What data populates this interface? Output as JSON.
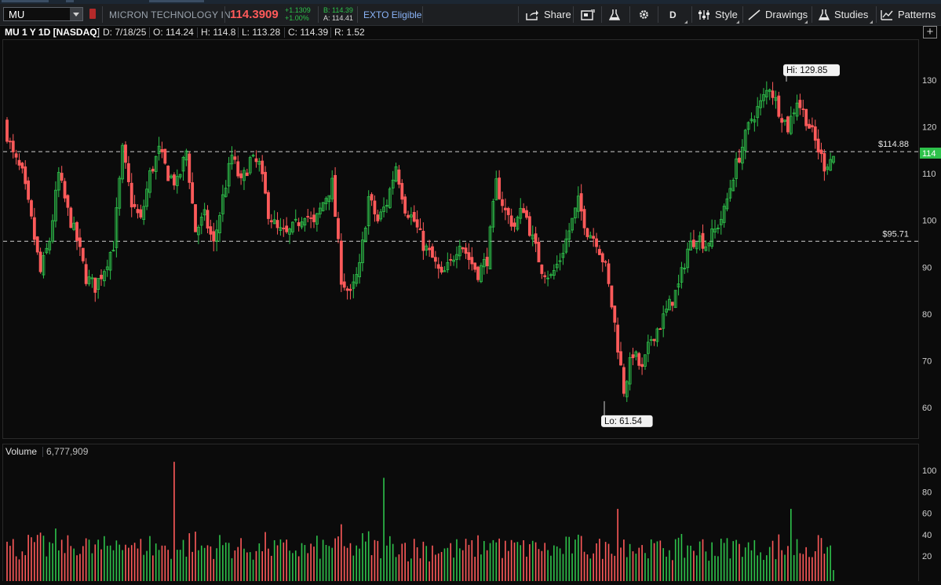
{
  "toolbar": {
    "symbol": "MU",
    "company_name": "MICRON TECHNOLOGY IN",
    "last_price": "114.3909",
    "net_change": "+1.1309",
    "pct_change": "+1.00%",
    "bid": "B: 114.39",
    "ask": "A: 114.41",
    "ext_tag": "EXTO Eligible",
    "share_label": "Share",
    "aggregation_label": "D",
    "style_label": "Style",
    "drawings_label": "Drawings",
    "studies_label": "Studies",
    "patterns_label": "Patterns",
    "colors": {
      "up": "#2ec24b",
      "down": "#ff5a5a",
      "accent": "#8ab4f8"
    }
  },
  "info_bar": {
    "title": "MU 1 Y 1D [NASDAQ]",
    "date": "D: 7/18/25",
    "open": "O: 114.24",
    "high": "H: 114.8",
    "low": "L: 113.28",
    "close": "C: 114.39",
    "range": "R: 1.52"
  },
  "volume_header": {
    "label": "Volume",
    "value": "6,777,909"
  },
  "chart_data": [
    {
      "type": "candlestick",
      "title": "MU 1 Y 1D [NASDAQ]",
      "ylim": [
        56,
        138
      ],
      "y_ticks": [
        60,
        70,
        80,
        90,
        100,
        110,
        120,
        130
      ],
      "grid": false,
      "high_marker": {
        "label": "Hi: 129.85",
        "value": 129.85,
        "date": "late June 2025"
      },
      "low_marker": {
        "label": "Lo: 61.54",
        "value": 61.54,
        "date": "early April 2025"
      },
      "price_lines": [
        {
          "label": "$114.88",
          "value": 114.88,
          "style": "dashed"
        },
        {
          "label": "$95.71",
          "value": 95.71,
          "style": "dashed"
        }
      ],
      "last_price_tag": {
        "label": "114",
        "value": 114.39,
        "color": "#2ec24b"
      },
      "candles_approx": [
        [
          121,
          114
        ],
        [
          114,
          110
        ],
        [
          110,
          100
        ],
        [
          100,
          89
        ],
        [
          89,
          96
        ],
        [
          96,
          110
        ],
        [
          110,
          102
        ],
        [
          102,
          96
        ],
        [
          96,
          88
        ],
        [
          88,
          86
        ],
        [
          86,
          90
        ],
        [
          90,
          95
        ],
        [
          95,
          115
        ],
        [
          115,
          104
        ],
        [
          104,
          100
        ],
        [
          100,
          110
        ],
        [
          110,
          115
        ],
        [
          115,
          110
        ],
        [
          110,
          108
        ],
        [
          108,
          115
        ],
        [
          115,
          98
        ],
        [
          98,
          101
        ],
        [
          101,
          95
        ],
        [
          95,
          105
        ],
        [
          105,
          114
        ],
        [
          114,
          108
        ],
        [
          108,
          113
        ],
        [
          113,
          112
        ],
        [
          112,
          102
        ],
        [
          102,
          98
        ],
        [
          98,
          97
        ],
        [
          97,
          99
        ],
        [
          99,
          102
        ],
        [
          102,
          99
        ],
        [
          99,
          104
        ],
        [
          104,
          108
        ],
        [
          108,
          88
        ],
        [
          88,
          84
        ],
        [
          84,
          90
        ],
        [
          90,
          105
        ],
        [
          105,
          100
        ],
        [
          100,
          104
        ],
        [
          104,
          112
        ],
        [
          112,
          103
        ],
        [
          103,
          100
        ],
        [
          100,
          95
        ],
        [
          95,
          92
        ],
        [
          92,
          88
        ],
        [
          88,
          91
        ],
        [
          91,
          96
        ],
        [
          96,
          92
        ],
        [
          92,
          89
        ],
        [
          89,
          92
        ],
        [
          92,
          108
        ],
        [
          108,
          102
        ],
        [
          102,
          99
        ],
        [
          99,
          103
        ],
        [
          103,
          96
        ],
        [
          96,
          90
        ],
        [
          90,
          88
        ],
        [
          88,
          92
        ],
        [
          92,
          98
        ],
        [
          98,
          104
        ],
        [
          104,
          98
        ],
        [
          98,
          96
        ],
        [
          96,
          90
        ],
        [
          90,
          78
        ],
        [
          78,
          64
        ],
        [
          64,
          72
        ],
        [
          72,
          68
        ],
        [
          68,
          75
        ],
        [
          75,
          78
        ],
        [
          78,
          82
        ],
        [
          82,
          86
        ],
        [
          86,
          94
        ],
        [
          94,
          97
        ],
        [
          97,
          95
        ],
        [
          95,
          98
        ],
        [
          98,
          102
        ],
        [
          102,
          110
        ],
        [
          110,
          116
        ],
        [
          116,
          122
        ],
        [
          122,
          125
        ],
        [
          125,
          129
        ],
        [
          129,
          124
        ],
        [
          124,
          120
        ],
        [
          120,
          126
        ],
        [
          126,
          122
        ],
        [
          122,
          117
        ],
        [
          117,
          112
        ],
        [
          112,
          114
        ]
      ]
    },
    {
      "type": "bar",
      "title": "Volume",
      "ylim": [
        0,
        110
      ],
      "y_ticks": [
        20,
        40,
        60,
        80,
        100
      ],
      "unit": "millions",
      "current_value": 6777909,
      "notable_spikes": [
        {
          "position": "mid-Sept 2024",
          "value": 108
        },
        {
          "position": "late Dec 2024",
          "value": 93
        },
        {
          "position": "early April 2025",
          "value": 64
        },
        {
          "position": "late June 2025",
          "value": 64
        }
      ]
    }
  ]
}
